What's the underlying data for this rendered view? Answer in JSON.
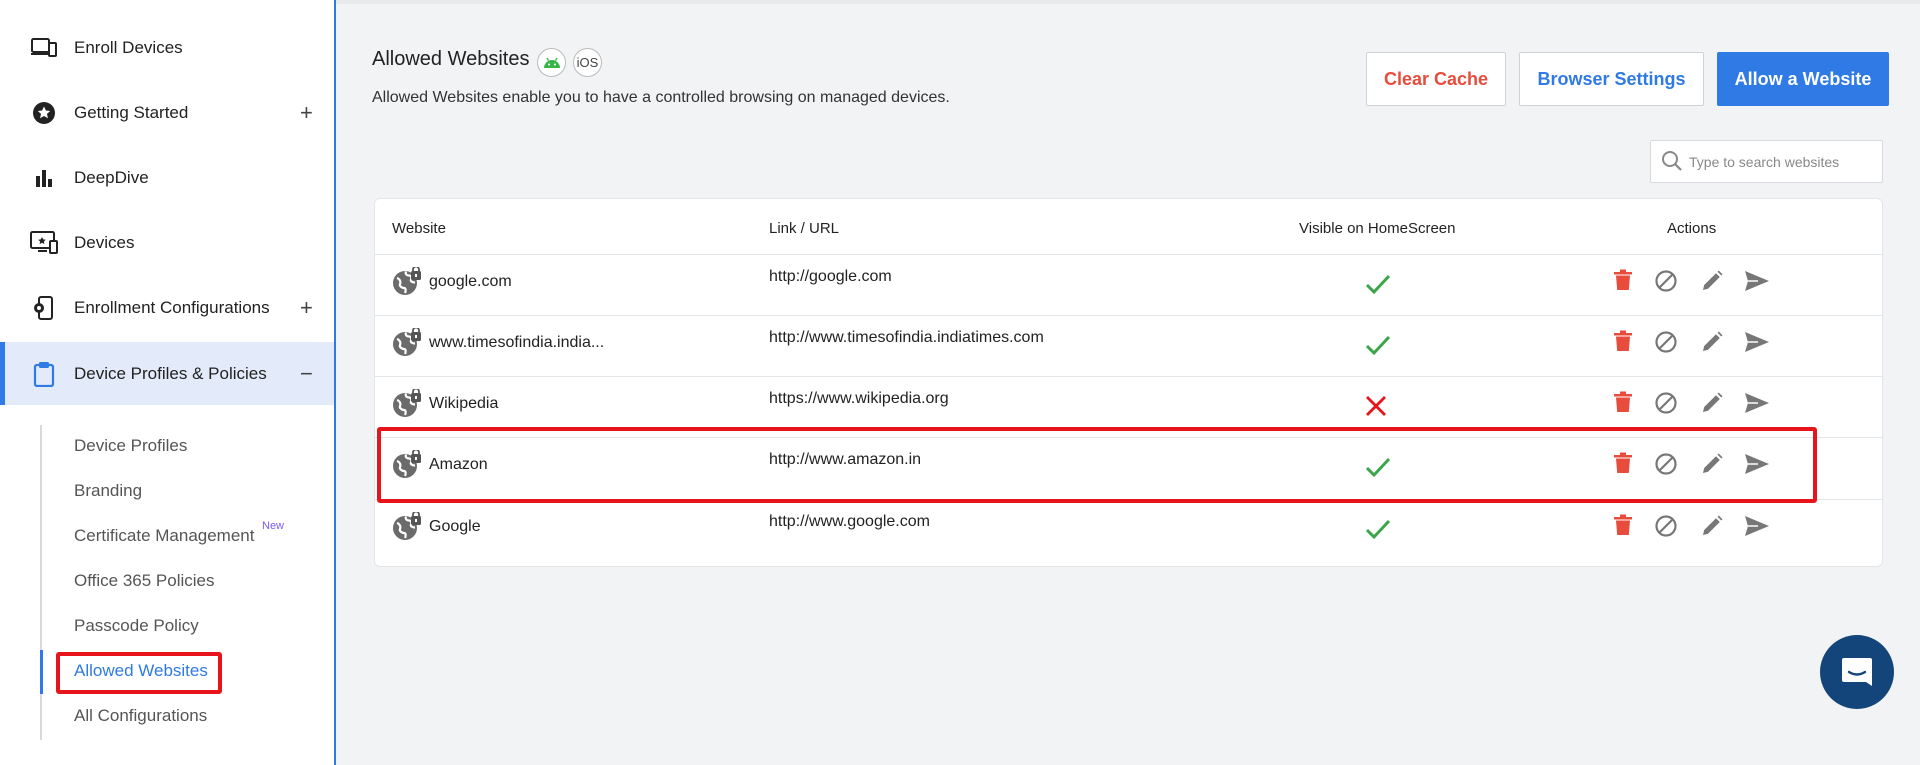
{
  "sidebar": {
    "items": [
      {
        "label": "Enroll Devices",
        "icon": "devices-icon",
        "expand": ""
      },
      {
        "label": "Getting Started",
        "icon": "star-circle-icon",
        "expand": "+"
      },
      {
        "label": "DeepDive",
        "icon": "bar-chart-icon",
        "expand": ""
      },
      {
        "label": "Devices",
        "icon": "monitor-icon",
        "expand": ""
      },
      {
        "label": "Enrollment Configurations",
        "icon": "phone-settings-icon",
        "expand": "+"
      },
      {
        "label": "Device Profiles & Policies",
        "icon": "clipboard-icon",
        "expand": "−"
      }
    ],
    "sub_items": [
      {
        "label": "Device Profiles"
      },
      {
        "label": "Branding"
      },
      {
        "label": "Certificate Management"
      },
      {
        "label": "Office 365 Policies"
      },
      {
        "label": "Passcode Policy"
      },
      {
        "label": "Allowed Websites"
      },
      {
        "label": "All Configurations"
      }
    ],
    "new_badge": "New"
  },
  "header": {
    "title": "Allowed Websites",
    "ios_badge": "iOS",
    "subtitle": "Allowed Websites enable you to have a controlled browsing on managed devices.",
    "clear_cache": "Clear Cache",
    "browser_settings": "Browser Settings",
    "allow_website": "Allow a Website"
  },
  "search": {
    "placeholder": "Type to search websites"
  },
  "table": {
    "columns": [
      "Website",
      "Link / URL",
      "Visible on HomeScreen",
      "Actions"
    ],
    "rows": [
      {
        "website": "google.com",
        "url": "http://google.com",
        "visible": true
      },
      {
        "website": "www.timesofindia.india...",
        "url": "http://www.timesofindia.indiatimes.com",
        "visible": true
      },
      {
        "website": "Wikipedia",
        "url": "https://www.wikipedia.org",
        "visible": false
      },
      {
        "website": "Amazon",
        "url": "http://www.amazon.in",
        "visible": true
      },
      {
        "website": "Google",
        "url": "http://www.google.com",
        "visible": true
      }
    ]
  },
  "colors": {
    "accent": "#2f7ae5",
    "danger": "#e74c3c",
    "check": "#3aa648",
    "highlight": "#e8141b"
  }
}
